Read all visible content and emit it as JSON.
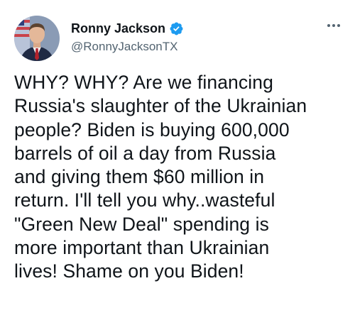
{
  "author": {
    "display_name": "Ronny Jackson",
    "handle": "@RonnyJacksonTX",
    "verified": true
  },
  "icons": {
    "verified": "verified-badge-icon",
    "more": "more-options-icon"
  },
  "colors": {
    "verified_blue": "#1d9bf0",
    "text_primary": "#0f1419",
    "text_secondary": "#536471"
  },
  "tweet": {
    "text": "WHY? WHY? Are we financing\nRussia's slaughter of the Ukrainian\npeople? Biden is buying 600,000\nbarrels of oil a day from Russia\nand giving them $60 million in\nreturn. I'll tell you why..wasteful\n\"Green New Deal\" spending is\nmore important than Ukrainian\nlives! Shame on you Biden!"
  }
}
